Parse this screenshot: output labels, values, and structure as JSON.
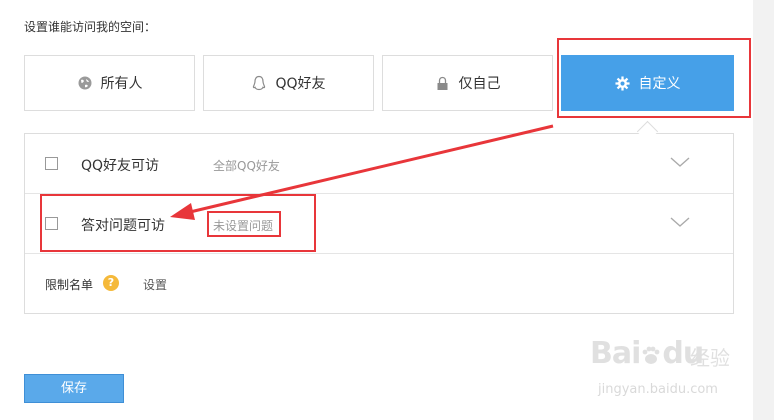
{
  "page": {
    "title": "设置谁能访问我的空间："
  },
  "access_options": [
    {
      "label": "所有人",
      "icon": "globe-icon",
      "active": false
    },
    {
      "label": "QQ好友",
      "icon": "person-icon",
      "active": false
    },
    {
      "label": "仅自己",
      "icon": "lock-icon",
      "active": false
    },
    {
      "label": "自定义",
      "icon": "gear-icon",
      "active": true
    }
  ],
  "custom_settings": {
    "rows": [
      {
        "label": "QQ好友可访",
        "description": "全部QQ好友",
        "checked": false
      },
      {
        "label": "答对问题可访",
        "description": "未设置问题",
        "checked": false
      }
    ],
    "limit_list": {
      "label": "限制名单",
      "help_icon": "?",
      "link": "设置"
    }
  },
  "footer": {
    "save_label": "保存"
  },
  "watermark": {
    "brand": "Bai",
    "brand_suffix": "du",
    "jingyan": "经验",
    "url": "jingyan.baidu.com"
  },
  "colors": {
    "accent": "#46a0e8",
    "annotation": "#e8363a",
    "help": "#f5b93a"
  }
}
